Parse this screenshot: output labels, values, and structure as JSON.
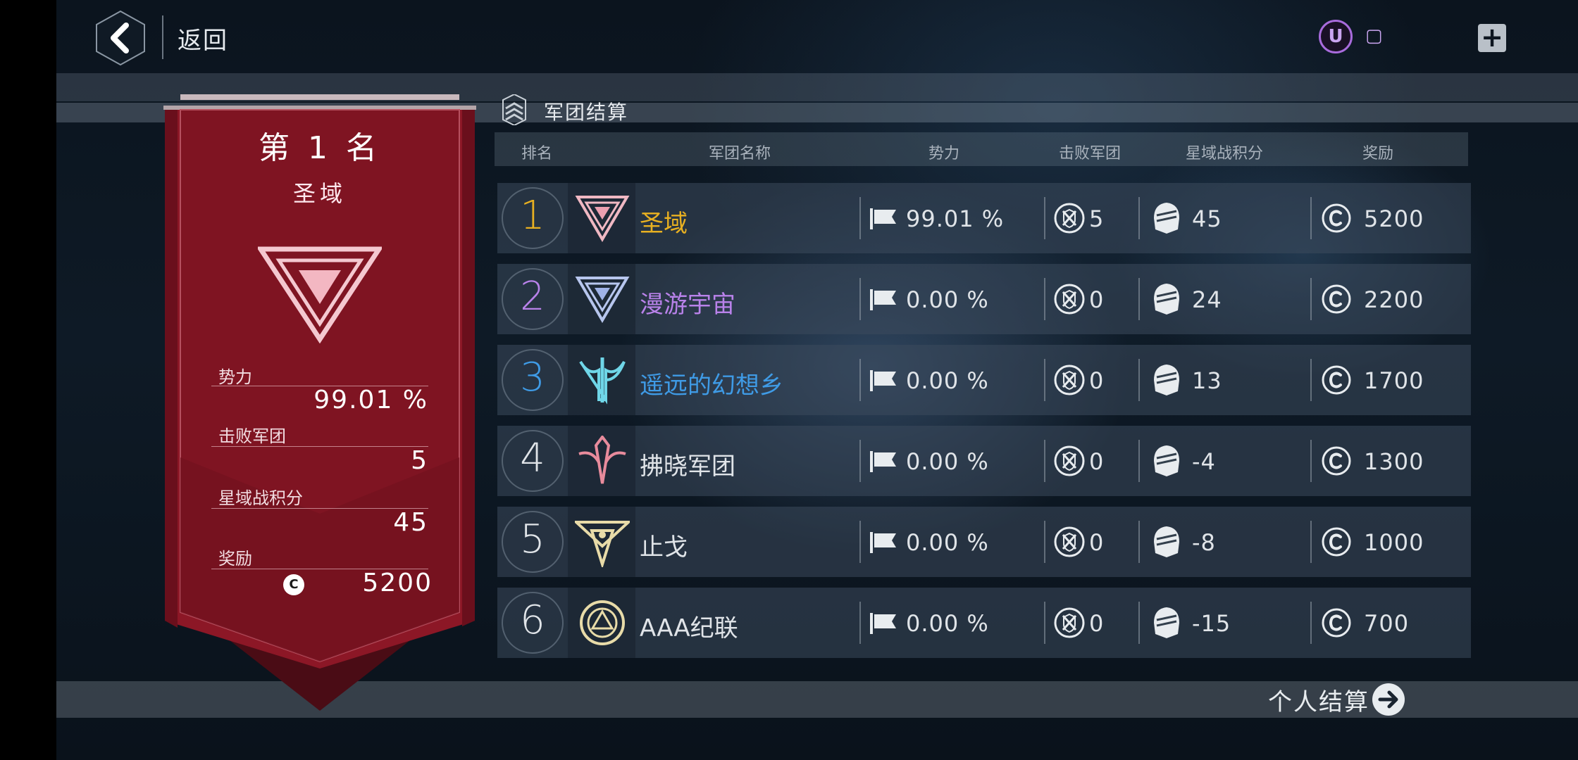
{
  "header": {
    "back_label": "返回",
    "currency_symbol": "U",
    "currency_value": "▢",
    "plus_label": "+"
  },
  "panel": {
    "title": "军团结算",
    "columns": [
      "排名",
      "军团名称",
      "势力",
      "击败军团",
      "星域战积分",
      "奖励"
    ]
  },
  "winner": {
    "title": "第 1 名",
    "name": "圣域",
    "stats": [
      {
        "label": "势力",
        "value": "99.01 %"
      },
      {
        "label": "击败军团",
        "value": "5"
      },
      {
        "label": "星域战积分",
        "value": "45"
      },
      {
        "label": "奖励",
        "value": "5200"
      }
    ],
    "coin_symbol": "C",
    "banner_color": "#8c1726"
  },
  "rows": [
    {
      "rank": "1",
      "name": "圣域",
      "rank_color": "#e8b021",
      "name_color": "#e8b021",
      "power": "99.01 %",
      "defeated": "5",
      "score": "45",
      "reward": "5200",
      "emblem": "triangle-emblem-pink"
    },
    {
      "rank": "2",
      "name": "漫游宇宙",
      "rank_color": "#b982ea",
      "name_color": "#b982ea",
      "power": "0.00 %",
      "defeated": "0",
      "score": "24",
      "reward": "2200",
      "emblem": "triangle-emblem-blue"
    },
    {
      "rank": "3",
      "name": "遥远的幻想乡",
      "rank_color": "#3f9be6",
      "name_color": "#3f9be6",
      "power": "0.00 %",
      "defeated": "0",
      "score": "13",
      "reward": "1700",
      "emblem": "trident-emblem-cyan"
    },
    {
      "rank": "4",
      "name": "拂晓军团",
      "rank_color": "#e0e4e8",
      "name_color": "#e0e4e8",
      "power": "0.00 %",
      "defeated": "0",
      "score": "-4",
      "reward": "1300",
      "emblem": "sword-emblem-pink"
    },
    {
      "rank": "5",
      "name": "止戈",
      "rank_color": "#e0e4e8",
      "name_color": "#e0e4e8",
      "power": "0.00 %",
      "defeated": "0",
      "score": "-8",
      "reward": "1000",
      "emblem": "star-emblem-gold"
    },
    {
      "rank": "6",
      "name": "AAA纪联",
      "rank_color": "#e0e4e8",
      "name_color": "#e0e4e8",
      "power": "0.00 %",
      "defeated": "0",
      "score": "-15",
      "reward": "700",
      "emblem": "circle-emblem-gold"
    }
  ],
  "footer": {
    "personal_label": "个人结算"
  },
  "icons": {
    "back": "chevron-left-icon",
    "power": "flag-icon",
    "defeated": "crossed-swords-shield-icon",
    "score": "helmet-icon",
    "reward": "coin-icon",
    "next": "arrow-right-icon"
  }
}
